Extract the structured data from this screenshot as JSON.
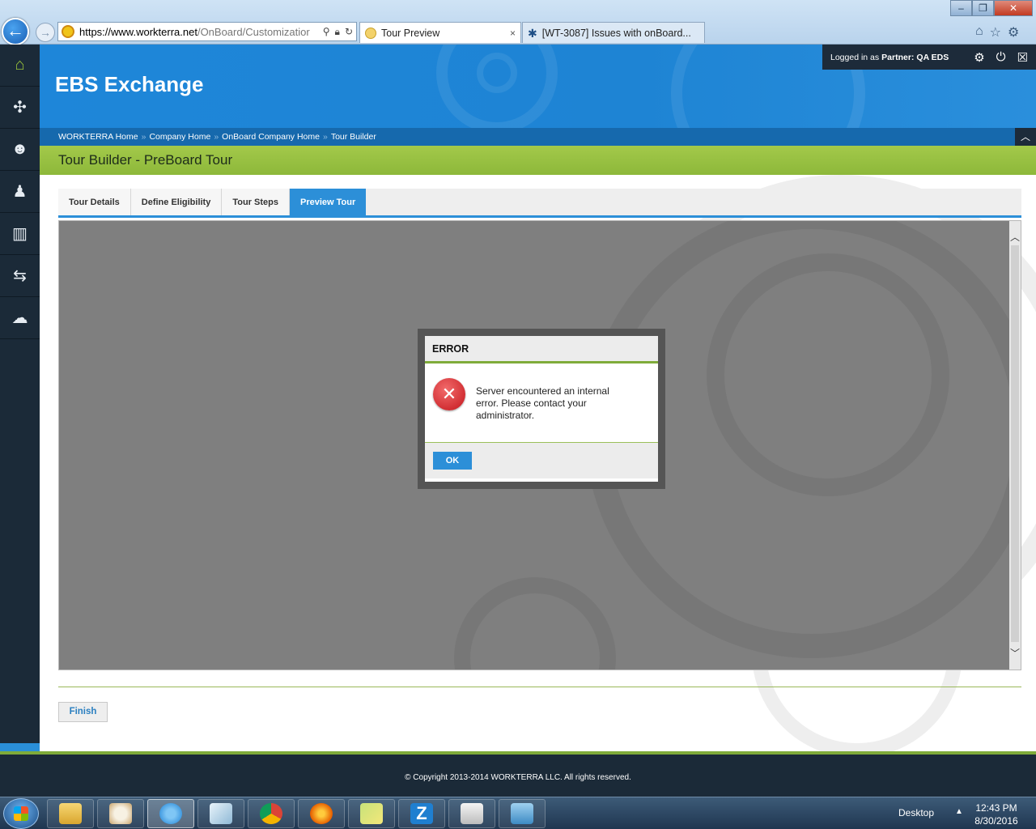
{
  "browser": {
    "url_main": "https://www.workterra.net",
    "url_rest": "/OnBoard/Customizatior",
    "tabs": [
      {
        "label": "Tour Preview",
        "close": "×"
      },
      {
        "label": "[WT-3087] Issues with onBoard..."
      }
    ],
    "icons": {
      "back": "back-arrow-icon",
      "forward": "forward-arrow-icon",
      "search": "search-icon",
      "lock": "lock-icon",
      "refresh": "refresh-icon",
      "home": "home-icon",
      "favorites": "star-icon",
      "tools": "gear-icon"
    }
  },
  "sidebar": {
    "items": [
      {
        "icon": "home-icon",
        "glyph": "⌂"
      },
      {
        "icon": "puzzle-icon",
        "glyph": "✣"
      },
      {
        "icon": "user-star-icon",
        "glyph": "☻"
      },
      {
        "icon": "user-icon",
        "glyph": "♟"
      },
      {
        "icon": "bar-chart-icon",
        "glyph": "▥"
      },
      {
        "icon": "transfer-icon",
        "glyph": "⇆"
      },
      {
        "icon": "chat-icon",
        "glyph": "☁"
      }
    ]
  },
  "header": {
    "title": "EBS Exchange",
    "logged_in_label": "Logged in as",
    "partner_label": "Partner:",
    "partner_name": "QA EDS",
    "icons": [
      "gear-icon",
      "power-icon",
      "close-icon"
    ]
  },
  "breadcrumb": [
    "WORKTERRA Home",
    "Company Home",
    "OnBoard Company Home",
    "Tour Builder"
  ],
  "breadcrumb_sep": "»",
  "page": {
    "title": "Tour Builder - PreBoard Tour",
    "tabs": [
      "Tour Details",
      "Define Eligibility",
      "Tour Steps",
      "Preview Tour"
    ],
    "selected_tab": "Preview Tour",
    "finish_label": "Finish"
  },
  "dialog": {
    "title": "ERROR",
    "message": "Server encountered an internal error. Please contact your administrator.",
    "ok_label": "OK"
  },
  "footer": {
    "copyright": "© Copyright 2013-2014 WORKTERRA LLC. All rights reserved."
  },
  "taskbar": {
    "desktop_label": "Desktop",
    "time": "12:43 PM",
    "date": "8/30/2016"
  },
  "colors": {
    "header_blue": "#1e86d9",
    "accent_green": "#8db83a",
    "tab_blue": "#2c8fd8",
    "sidebar_dark": "#1b2a38",
    "error_red": "#c4151c"
  }
}
